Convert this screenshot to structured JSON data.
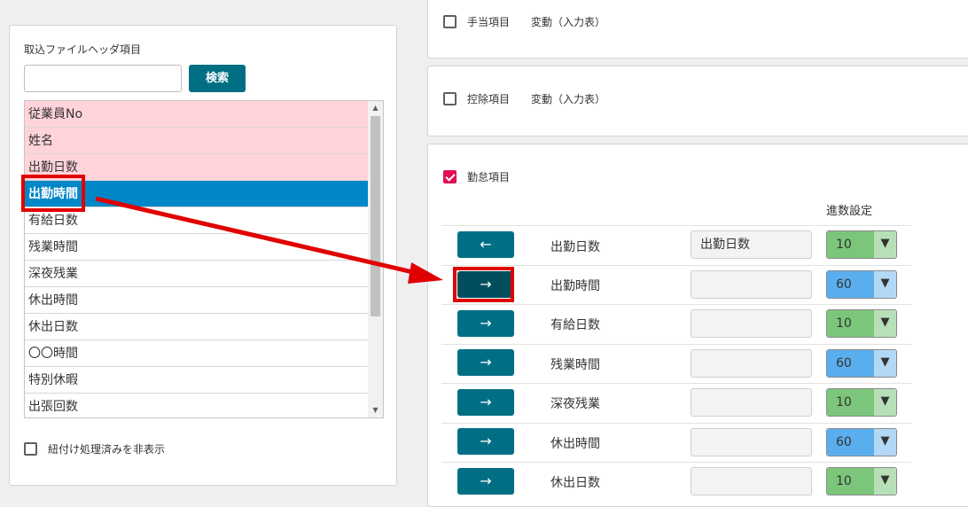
{
  "left": {
    "title": "取込ファイルヘッダ項目",
    "search_placeholder": "",
    "search_button": "検索",
    "list": [
      {
        "label": "従業員No",
        "state": "mapped"
      },
      {
        "label": "姓名",
        "state": "mapped"
      },
      {
        "label": "出勤日数",
        "state": "mapped"
      },
      {
        "label": "出勤時間",
        "state": "selected"
      },
      {
        "label": "有給日数",
        "state": "normal"
      },
      {
        "label": "残業時間",
        "state": "normal"
      },
      {
        "label": "深夜残業",
        "state": "normal"
      },
      {
        "label": "休出時間",
        "state": "normal"
      },
      {
        "label": "休出日数",
        "state": "normal"
      },
      {
        "label": "〇〇時間",
        "state": "normal"
      },
      {
        "label": "特別休暇",
        "state": "normal"
      },
      {
        "label": "出張回数",
        "state": "normal"
      }
    ],
    "hide_processed_label": "紐付け処理済みを非表示",
    "hide_processed_checked": false
  },
  "sections": {
    "allowance": {
      "label": "手当項目",
      "type": "変動（入力表）",
      "checked": false
    },
    "deduction": {
      "label": "控除項目",
      "type": "変動（入力表）",
      "checked": false
    },
    "attendance": {
      "label": "勤怠項目",
      "checked": true,
      "decimal_header": "進数設定"
    }
  },
  "rows": [
    {
      "button": "←",
      "label": "出勤日数",
      "mapped": "出勤日数",
      "select": "10",
      "select_color": "green"
    },
    {
      "button": "→",
      "label": "出勤時間",
      "mapped": "",
      "select": "60",
      "select_color": "blue"
    },
    {
      "button": "→",
      "label": "有給日数",
      "mapped": "",
      "select": "10",
      "select_color": "green"
    },
    {
      "button": "→",
      "label": "残業時間",
      "mapped": "",
      "select": "60",
      "select_color": "blue"
    },
    {
      "button": "→",
      "label": "深夜残業",
      "mapped": "",
      "select": "10",
      "select_color": "green"
    },
    {
      "button": "→",
      "label": "休出時間",
      "mapped": "",
      "select": "60",
      "select_color": "blue"
    },
    {
      "button": "→",
      "label": "休出日数",
      "mapped": "",
      "select": "10",
      "select_color": "green"
    }
  ],
  "select_arrow": "▼",
  "colors": {
    "teal": "#006f84",
    "mapped_row": "#ffd3da",
    "selected_row": "#0087c7",
    "checkbox_checked": "#e10f55",
    "select_green": "#7bc67b",
    "select_blue": "#5baeee",
    "highlight_red": "#e00000"
  }
}
